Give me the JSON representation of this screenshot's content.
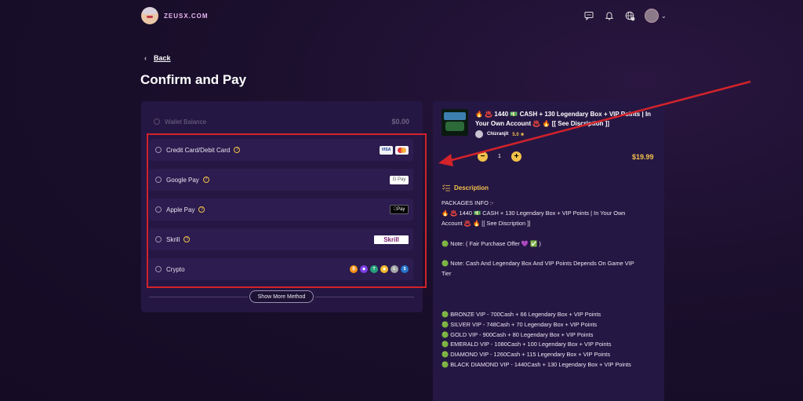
{
  "header": {
    "brand": "ZEUSX.COM",
    "icons": [
      "chat-icon",
      "bell-icon",
      "globe-icon"
    ]
  },
  "nav": {
    "back_label": "Back",
    "back_arrow": "‹"
  },
  "page_title": "Confirm and Pay",
  "wallet": {
    "label": "Wallet Balance",
    "amount": "$0.00"
  },
  "methods": [
    {
      "label": "Credit Card/Debit Card",
      "help": true,
      "logos": [
        "VISA",
        "mastercard"
      ]
    },
    {
      "label": "Google Pay",
      "help": true,
      "logos": [
        "G Pay"
      ]
    },
    {
      "label": "Apple Pay",
      "help": true,
      "logos": [
        "Pay"
      ]
    },
    {
      "label": "Skrill",
      "help": true,
      "logos": [
        "Skrill"
      ]
    },
    {
      "label": "Crypto",
      "help": false,
      "logos": [
        "bitcoin",
        "ethereum",
        "tether",
        "bnb",
        "litecoin",
        "usdc"
      ]
    }
  ],
  "show_more_label": "Show More Method",
  "product": {
    "title_line1": "🔥 ♨️ 1440 💵 CASH + 130 Legendary Box + VIP Points | In",
    "title_line2": "Your Own Account ♨️ 🔥 [[ See Discription ]]",
    "seller_name": "Chizranjit",
    "seller_rating": "5.0 ★",
    "quantity": "1",
    "minus": "−",
    "plus": "+",
    "price": "$19.99"
  },
  "description": {
    "heading": "Description",
    "lines": [
      "PACKAGES INFO :-",
      "🔥 ♨️ 1440 💵 CASH + 130 Legendary Box + VIP Points | In Your Own",
      "Account ♨️ 🔥 [[ See Discription ]]",
      "",
      "🟢 Note: ( Fair Purchase Offer 💜 ✅ )",
      "",
      "🟢 Note: Cash And Legendary Box And VIP Points Depends On Game VIP",
      "Tier",
      "",
      "",
      "",
      "🟢 BRONZE VIP   -  700Cash + 66 Legendary Box + VIP Points",
      "🟢 SILVER VIP   -  748Cash + 70 Legendary Box + VIP Points",
      "🟢 GOLD VIP     -  900Cash + 80 Legendary Box + VIP Points",
      "🟢 EMERALD VIP  -  1080Cash + 100 Legendary Box + VIP Points",
      "🟢 DIAMOND VIP  -  1260Cash + 115 Legendary Box + VIP Points",
      "🟢 BLACK DIAMOND VIP - 1440Cash + 130 Legendary Box + VIP Points"
    ]
  },
  "colors": {
    "accent": "#f2c14a",
    "highlight": "#d2232a",
    "panel": "#251743"
  }
}
